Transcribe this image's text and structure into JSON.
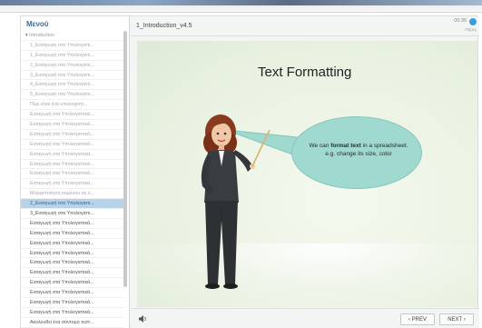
{
  "sidebar": {
    "title": "Μενού",
    "items": [
      {
        "label": "Introduction",
        "state": "parent"
      },
      {
        "label": "1_Εισαγωγή στα Υπολογιστι...",
        "state": "faded"
      },
      {
        "label": "1_Εισαγωγή στα Υπολογιστι...",
        "state": "faded"
      },
      {
        "label": "2_Εισαγωγή στα Υπολογιστι...",
        "state": "faded"
      },
      {
        "label": "3_Εισαγωγή στα Υπολογιστι...",
        "state": "faded"
      },
      {
        "label": "4_Εισαγωγή στα Υπολογιστι...",
        "state": "faded"
      },
      {
        "label": "5_Εισαγωγή στα Υπολογιστι...",
        "state": "faded"
      },
      {
        "label": "Πώς είναι ένα υπολογιστι...",
        "state": "faded"
      },
      {
        "label": "Εισαγωγή στα Υπολογιστικά...",
        "state": "faded"
      },
      {
        "label": "Εισαγωγή στα Υπολογιστικά...",
        "state": "faded"
      },
      {
        "label": "Εισαγωγή στα Υπολογιστικά...",
        "state": "faded"
      },
      {
        "label": "Εισαγωγή στα Υπολογιστικά...",
        "state": "faded"
      },
      {
        "label": "Εισαγωγή στα Υπολογιστικά...",
        "state": "faded"
      },
      {
        "label": "Εισαγωγή στα Υπολογιστικά...",
        "state": "faded"
      },
      {
        "label": "Εισαγωγή στα Υπολογιστικά...",
        "state": "faded"
      },
      {
        "label": "Εισαγωγή στα Υπολογιστικά...",
        "state": "faded"
      },
      {
        "label": "Μορφοποίηση κειμένου σε υ...",
        "state": "faded"
      },
      {
        "label": "2_Εισαγωγή στα Υπολογιστι...",
        "state": "active"
      },
      {
        "label": "3_Εισαγωγή στα Υπολογιστι...",
        "state": "normal"
      },
      {
        "label": "Εισαγωγή στα Υπολογιστικά...",
        "state": "normal"
      },
      {
        "label": "Εισαγωγή στα Υπολογιστικά...",
        "state": "normal"
      },
      {
        "label": "Εισαγωγή στα Υπολογιστικά...",
        "state": "normal"
      },
      {
        "label": "Εισαγωγή στα Υπολογιστικά...",
        "state": "normal"
      },
      {
        "label": "Εισαγωγή στα Υπολογιστικά...",
        "state": "normal"
      },
      {
        "label": "Εισαγωγή στα Υπολογιστικά...",
        "state": "normal"
      },
      {
        "label": "Εισαγωγή στα Υπολογιστικά...",
        "state": "normal"
      },
      {
        "label": "Εισαγωγή στα Υπολογιστικά...",
        "state": "normal"
      },
      {
        "label": "Εισαγωγή στα Υπολογιστικά...",
        "state": "normal"
      },
      {
        "label": "Εισαγωγή στα Υπολογιστικά...",
        "state": "normal"
      },
      {
        "label": "Ακολουθεί ένα σύντομο τεστ...",
        "state": "normal"
      }
    ]
  },
  "header": {
    "slide_name": "1_Introduction_v4.5",
    "timer": "00:35",
    "more_label": "Πάρες"
  },
  "slide": {
    "title": "Text Formatting",
    "bubble_pre": "We can ",
    "bubble_bold": "format text",
    "bubble_post": " in a spreadsheet. e.g. change its size, color"
  },
  "controls": {
    "prev_label": "‹ PREV",
    "next_label": "NEXT ›"
  },
  "colors": {
    "accent": "#39a0db",
    "active_item": "#b7d3ea",
    "bubble": "#9fd9cf",
    "slide_bg": "#e8f1e0"
  },
  "icons": {
    "volume": "speaker-icon",
    "status": "status-dot-icon"
  }
}
